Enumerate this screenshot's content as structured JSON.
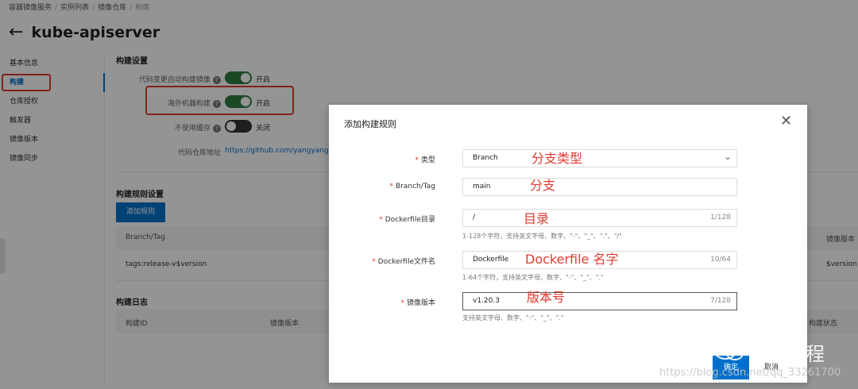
{
  "breadcrumb": [
    "容器镜像服务",
    "实例列表",
    "镜像仓库",
    "构建"
  ],
  "page": {
    "title": "kube-apiserver"
  },
  "sidebar": {
    "items": [
      {
        "label": "基本信息"
      },
      {
        "label": "构建",
        "active": true
      },
      {
        "label": "仓库授权"
      },
      {
        "label": "触发器"
      },
      {
        "label": "镜像版本"
      },
      {
        "label": "镜像同步"
      }
    ]
  },
  "build_settings": {
    "title": "构建设置",
    "auto_build": {
      "label": "代码变更自动构建镜像",
      "state": "开启",
      "on": true
    },
    "overseas_build": {
      "label": "海外机器构建",
      "state": "开启",
      "on": true
    },
    "no_cache": {
      "label": "不使用缓存",
      "state": "关闭",
      "on": false
    },
    "repo": {
      "label": "代码仓库地址",
      "url": "https://github.com/yangyang09"
    }
  },
  "build_rules": {
    "title": "构建规则设置",
    "add_button": "添加规则",
    "columns": {
      "branch_tag": "Branch/Tag",
      "image_version": "镜像版本"
    },
    "rows": [
      {
        "branch_tag": "tags:release-v$version",
        "image_version": "$version"
      }
    ]
  },
  "build_log": {
    "title": "构建日志",
    "columns": {
      "build_id": "构建ID",
      "image_version": "镜像版本",
      "status": "构建状态"
    }
  },
  "dialog": {
    "title": "添加构建规则",
    "fields": {
      "type": {
        "label": "类型",
        "value": "Branch"
      },
      "branch_tag": {
        "label": "Branch/Tag",
        "value": "main"
      },
      "dockerfile_dir": {
        "label": "Dockerfile目录",
        "value": "/",
        "count": "1/128",
        "hint": "1-128个字符，支持英文字母、数字、\"-\"、\"_\"、\".\"、\"/\""
      },
      "dockerfile_name": {
        "label": "Dockerfile文件名",
        "value": "Dockerfile",
        "count": "10/64",
        "hint": "1-64个字符，支持英文字母、数字、\"-\"、\"_\"、\".\""
      },
      "image_version": {
        "label": "镜像版本",
        "value": "v1.20.3",
        "count": "7/128",
        "hint": "支持英文字母、数字、\"-\"、\"_\"、\".\""
      }
    },
    "annotations": {
      "type": "分支类型",
      "branch": "分支",
      "dir": "目录",
      "name": "Dockerfile 名字",
      "version": "版本号"
    },
    "confirm": "确定",
    "cancel": "取消"
  },
  "watermark": {
    "brand": "山河编程",
    "url": "https://blog.csdn.net/qq_33261700"
  },
  "colors": {
    "accent": "#0070cc",
    "switch_on": "#2f7d3f",
    "annotation": "#e03b2f"
  }
}
